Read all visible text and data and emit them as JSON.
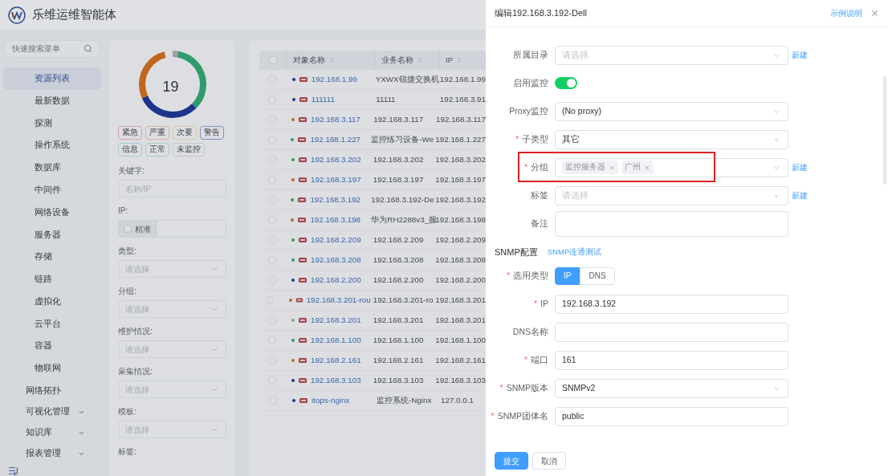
{
  "app": {
    "title": "乐维运维智能体"
  },
  "sidebar": {
    "search_placeholder": "快速搜索菜单",
    "items": [
      {
        "kind": "child",
        "label": "资源列表",
        "selected": true
      },
      {
        "kind": "child",
        "label": "最新数据",
        "selected": false
      },
      {
        "kind": "child",
        "label": "探测",
        "selected": false
      },
      {
        "kind": "child",
        "label": "操作系统",
        "selected": false
      },
      {
        "kind": "child",
        "label": "数据库",
        "selected": false
      },
      {
        "kind": "child",
        "label": "中间件",
        "selected": false
      },
      {
        "kind": "child",
        "label": "网络设备",
        "selected": false
      },
      {
        "kind": "child",
        "label": "服务器",
        "selected": false
      },
      {
        "kind": "child",
        "label": "存储",
        "selected": false
      },
      {
        "kind": "child",
        "label": "链路",
        "selected": false
      },
      {
        "kind": "child",
        "label": "虚拟化",
        "selected": false
      },
      {
        "kind": "child",
        "label": "云平台",
        "selected": false
      },
      {
        "kind": "child",
        "label": "容器",
        "selected": false
      },
      {
        "kind": "child",
        "label": "物联网",
        "selected": false
      },
      {
        "kind": "leaf",
        "label": "网络拓扑",
        "selected": false
      },
      {
        "kind": "group",
        "label": "可视化管理",
        "selected": false
      },
      {
        "kind": "group",
        "label": "知识库",
        "selected": false
      },
      {
        "kind": "group",
        "label": "报表管理",
        "selected": false
      }
    ]
  },
  "filter": {
    "total": "19",
    "status_tags": [
      {
        "label": "紧急",
        "color": "#d4a3a3"
      },
      {
        "label": "严重",
        "color": "#d8b39a"
      },
      {
        "label": "次要",
        "color": "#d9c999"
      },
      {
        "label": "警告",
        "color": "#7f8fbf"
      },
      {
        "label": "信息",
        "color": "#a6c9d2"
      },
      {
        "label": "正常",
        "color": "#a6cfbf"
      },
      {
        "label": "未监控",
        "color": "#c4c6ca"
      }
    ],
    "fields": [
      {
        "kind": "input",
        "label": "关键字:",
        "placeholder": "名称/IP"
      },
      {
        "kind": "ip",
        "label": "IP:",
        "checkbox_label": "精准",
        "checked": false
      },
      {
        "kind": "select",
        "label": "类型:",
        "placeholder": "请选择"
      },
      {
        "kind": "select",
        "label": "分组:",
        "placeholder": "请选择"
      },
      {
        "kind": "select",
        "label": "维护情况:",
        "placeholder": "请选择"
      },
      {
        "kind": "select",
        "label": "采集情况:",
        "placeholder": "请选择"
      },
      {
        "kind": "select",
        "label": "模板:",
        "placeholder": "请选择"
      },
      {
        "kind": "label",
        "label": "标签:"
      }
    ]
  },
  "table": {
    "select_all_checked": false,
    "columns": [
      {
        "label": "对象名称"
      },
      {
        "label": "业务名称"
      },
      {
        "label": "IP"
      }
    ],
    "rows": [
      {
        "checked": false,
        "color": "#1f3a8a",
        "name": "192.168.1.99",
        "business": "YXWX锐捷交换机",
        "ip": "192.168.1.99"
      },
      {
        "checked": false,
        "color": "#1f3a8a",
        "name": "111111",
        "business": "11111",
        "ip": "192.168.3.91"
      },
      {
        "checked": false,
        "color": "#c06a1c",
        "name": "192.168.3.117",
        "business": "192.168.3.117",
        "ip": "192.168.3.117"
      },
      {
        "checked": false,
        "color": "#2e9a6a",
        "name": "192.168.1.227",
        "business": "监控练习设备-We",
        "ip": "192.168.1.227"
      },
      {
        "checked": false,
        "color": "#2e9a6a",
        "name": "192.168.3.202",
        "business": "192.168.3.202",
        "ip": "192.168.3.202"
      },
      {
        "checked": false,
        "color": "#c06a1c",
        "name": "192.168.3.197",
        "business": "192.168.3.197",
        "ip": "192.168.3.197"
      },
      {
        "checked": false,
        "color": "#2e9a6a",
        "name": "192.168.3.192",
        "business": "192.168.3.192-De",
        "ip": "192.168.3.192"
      },
      {
        "checked": false,
        "color": "#c06a1c",
        "name": "192.168.3.198",
        "business": "华为RH2288v3_服",
        "ip": "192.168.3.198"
      },
      {
        "checked": false,
        "color": "#2e9a6a",
        "name": "192.168.2.209",
        "business": "192.168.2.209",
        "ip": "192.168.2.209"
      },
      {
        "checked": false,
        "color": "#2e9a6a",
        "name": "192.168.3.208",
        "business": "192.168.3.208",
        "ip": "192.168.3.208"
      },
      {
        "checked": false,
        "color": "#1f3a8a",
        "name": "192.168.2.200",
        "business": "192.168.2.200",
        "ip": "192.168.2.200"
      },
      {
        "checked": false,
        "color": "#c06a1c",
        "name": "192.168.3.201-rou",
        "business": "192.168.3.201-ro",
        "ip": "192.168.3.201"
      },
      {
        "checked": false,
        "color": "#9a9a9a",
        "name": "192.168.3.201",
        "business": "192.168.3.201",
        "ip": "192.168.3.201"
      },
      {
        "checked": false,
        "color": "#2e9a6a",
        "name": "192.168.1.100",
        "business": "192.168.1.100",
        "ip": "192.168.1.100"
      },
      {
        "checked": false,
        "color": "#c06a1c",
        "name": "192.168.2.161",
        "business": "192.168.2.161",
        "ip": "192.168.2.161"
      },
      {
        "checked": false,
        "color": "#1f3a8a",
        "name": "192.168.3.103",
        "business": "192.168.3.103",
        "ip": "192.168.3.103"
      },
      {
        "checked": false,
        "color": "#1f3a8a",
        "name": "itops-nginx",
        "business": "监控系统-Nginx",
        "ip": "127.0.0.1"
      }
    ]
  },
  "drawer": {
    "title": "编辑192.168.3.192-Dell",
    "help_link": "示例说明",
    "rows": [
      {
        "kind": "select",
        "label": "所属目录",
        "placeholder": "请选择",
        "new_link": "新建"
      },
      {
        "kind": "toggle",
        "label": "启用监控",
        "on": true
      },
      {
        "kind": "select",
        "label": "Proxy监控",
        "value": "(No proxy)"
      },
      {
        "kind": "select",
        "label": "子类型",
        "required_mark": "*",
        "value": "其它"
      },
      {
        "kind": "tags",
        "label": "分组",
        "required_mark": "*",
        "highlighted": true,
        "tags": [
          "监控服务器",
          "广州"
        ],
        "new_link": "新建"
      },
      {
        "kind": "select",
        "label": "标签",
        "placeholder": "请选择",
        "new_link": "新建"
      },
      {
        "kind": "textarea",
        "label": "备注"
      }
    ],
    "section": {
      "title": "SNMP配置",
      "link": "SNMP连通测试"
    },
    "snmp_rows": [
      {
        "kind": "segmented",
        "label": "选用类型",
        "required_mark": "*",
        "options": [
          {
            "label": "IP",
            "selected": true
          },
          {
            "label": "DNS",
            "selected": false
          }
        ]
      },
      {
        "kind": "input",
        "label": "IP",
        "required_mark": "*",
        "value": "192.168.3.192"
      },
      {
        "kind": "input",
        "label": "DNS名称"
      },
      {
        "kind": "input",
        "label": "端口",
        "required_mark": "*",
        "value": "161"
      },
      {
        "kind": "select",
        "label": "SNMP版本",
        "required_mark": "*",
        "value": "SNMPv2"
      },
      {
        "kind": "input",
        "label": "SNMP团体名",
        "required_mark": "*",
        "value": "public"
      }
    ],
    "buttons": [
      {
        "label": "提交",
        "primary": true
      },
      {
        "label": "取消",
        "primary": false
      }
    ]
  }
}
